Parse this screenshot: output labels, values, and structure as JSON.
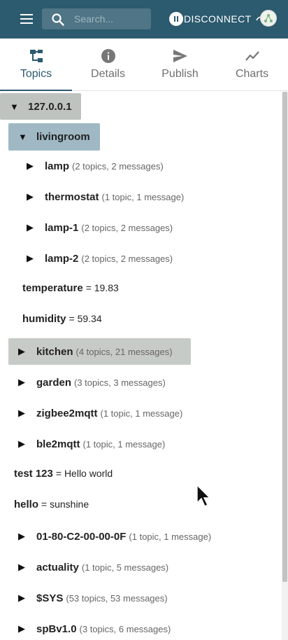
{
  "header": {
    "search_placeholder": "Search...",
    "disconnect_label": "DISCONNECT",
    "bar_color": "#2c5a6e"
  },
  "tabs": [
    {
      "label": "Topics",
      "icon": "topics-tree-icon",
      "active": true
    },
    {
      "label": "Details",
      "icon": "info-icon",
      "active": false
    },
    {
      "label": "Publish",
      "icon": "send-icon",
      "active": false
    },
    {
      "label": "Charts",
      "icon": "chart-line-icon",
      "active": false
    }
  ],
  "tree": [
    {
      "arrow": "▼",
      "name": "127.0.0.1",
      "meta": "",
      "value": ""
    },
    {
      "arrow": "▼",
      "name": "livingroom",
      "meta": "",
      "value": ""
    },
    {
      "arrow": "▶",
      "name": "lamp",
      "meta": "(2 topics, 2 messages)",
      "value": ""
    },
    {
      "arrow": "▶",
      "name": "thermostat",
      "meta": "(1 topic, 1 message)",
      "value": ""
    },
    {
      "arrow": "▶",
      "name": "lamp-1",
      "meta": "(2 topics, 2 messages)",
      "value": ""
    },
    {
      "arrow": "▶",
      "name": "lamp-2",
      "meta": "(2 topics, 2 messages)",
      "value": ""
    },
    {
      "arrow": "",
      "name": "temperature",
      "meta": "",
      "value": "= 19.83"
    },
    {
      "arrow": "",
      "name": "humidity",
      "meta": "",
      "value": "= 59.34"
    },
    {
      "arrow": "▶",
      "name": "kitchen",
      "meta": "(4 topics, 21 messages)",
      "value": ""
    },
    {
      "arrow": "▶",
      "name": "garden",
      "meta": "(3 topics, 3 messages)",
      "value": ""
    },
    {
      "arrow": "▶",
      "name": "zigbee2mqtt",
      "meta": "(1 topic, 1 message)",
      "value": ""
    },
    {
      "arrow": "▶",
      "name": "ble2mqtt",
      "meta": "(1 topic, 1 message)",
      "value": ""
    },
    {
      "arrow": "",
      "name": "test 123",
      "meta": "",
      "value": "= Hello world"
    },
    {
      "arrow": "",
      "name": "hello",
      "meta": "",
      "value": "= sunshine"
    },
    {
      "arrow": "▶",
      "name": "01-80-C2-00-00-0F",
      "meta": "(1 topic, 1 message)",
      "value": ""
    },
    {
      "arrow": "▶",
      "name": "actuality",
      "meta": "(1 topic, 5 messages)",
      "value": ""
    },
    {
      "arrow": "▶",
      "name": "$SYS",
      "meta": "(53 topics, 53 messages)",
      "value": ""
    },
    {
      "arrow": "▶",
      "name": "spBv1.0",
      "meta": "(3 topics, 6 messages)",
      "value": ""
    }
  ]
}
